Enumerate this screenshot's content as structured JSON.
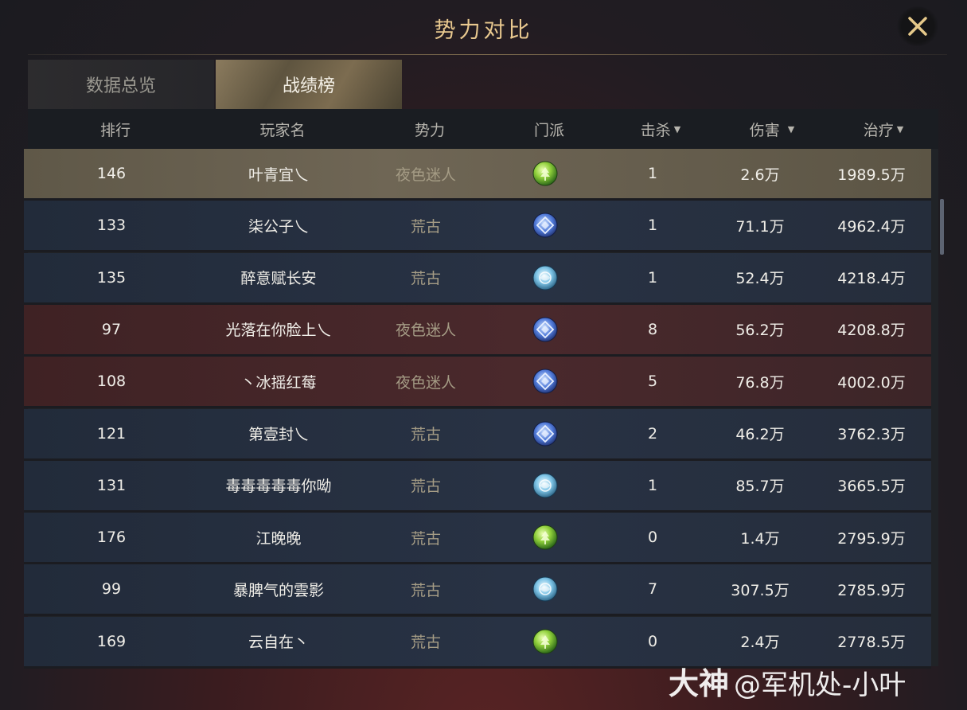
{
  "title": "势力对比",
  "tabs": [
    {
      "label": "数据总览",
      "active": false
    },
    {
      "label": "战绩榜",
      "active": true
    }
  ],
  "columns": {
    "rank": "排行",
    "player": "玩家名",
    "faction": "势力",
    "sect": "门派",
    "kills": "击杀",
    "damage": "伤害",
    "healing": "治疗"
  },
  "sort_arrow": "▼",
  "rows": [
    {
      "rank": "146",
      "player": "叶青宜乀",
      "faction": "夜色迷人",
      "sect_icon": "green-tree-sect-icon",
      "kills": "1",
      "damage": "2.6万",
      "healing": "1989.5万",
      "style": "selected"
    },
    {
      "rank": "133",
      "player": "柒公子乀",
      "faction": "荒古",
      "sect_icon": "blue-diamond-sect-icon",
      "kills": "1",
      "damage": "71.1万",
      "healing": "4962.4万",
      "style": "blue"
    },
    {
      "rank": "135",
      "player": "醉意赋长安",
      "faction": "荒古",
      "sect_icon": "cyan-orb-sect-icon",
      "kills": "1",
      "damage": "52.4万",
      "healing": "4218.4万",
      "style": "blue"
    },
    {
      "rank": "97",
      "player": "光落在你脸上乀",
      "faction": "夜色迷人",
      "sect_icon": "blue-diamond-sect-icon",
      "kills": "8",
      "damage": "56.2万",
      "healing": "4208.8万",
      "style": "red"
    },
    {
      "rank": "108",
      "player": "丶冰摇红莓",
      "faction": "夜色迷人",
      "sect_icon": "blue-diamond-sect-icon",
      "kills": "5",
      "damage": "76.8万",
      "healing": "4002.0万",
      "style": "red"
    },
    {
      "rank": "121",
      "player": "第壹封乀",
      "faction": "荒古",
      "sect_icon": "blue-diamond-sect-icon",
      "kills": "2",
      "damage": "46.2万",
      "healing": "3762.3万",
      "style": "blue"
    },
    {
      "rank": "131",
      "player": "毒毒毒毒毒你呦",
      "faction": "荒古",
      "sect_icon": "cyan-orb-sect-icon",
      "kills": "1",
      "damage": "85.7万",
      "healing": "3665.5万",
      "style": "blue"
    },
    {
      "rank": "176",
      "player": "江晚晚",
      "faction": "荒古",
      "sect_icon": "green-tree-sect-icon",
      "kills": "0",
      "damage": "1.4万",
      "healing": "2795.9万",
      "style": "blue"
    },
    {
      "rank": "99",
      "player": "暴脾气的雲影",
      "faction": "荒古",
      "sect_icon": "cyan-orb-sect-icon",
      "kills": "7",
      "damage": "307.5万",
      "healing": "2785.9万",
      "style": "blue"
    },
    {
      "rank": "169",
      "player": "云自在丶",
      "faction": "荒古",
      "sect_icon": "green-tree-sect-icon",
      "kills": "0",
      "damage": "2.4万",
      "healing": "2778.5万",
      "style": "blue"
    }
  ],
  "watermark": {
    "brand": "大神",
    "handle": "@军机处-小叶"
  },
  "colors": {
    "title": "#e9c98f",
    "faction_text": "#a59c85",
    "blue_row": "#283244",
    "red_row": "#4a292c",
    "selected_row": "#6f6655"
  }
}
